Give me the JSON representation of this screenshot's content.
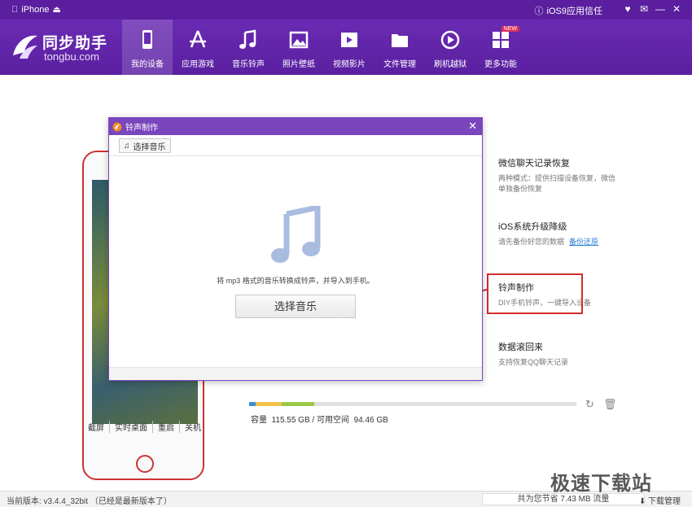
{
  "titlebar": {
    "device": "iPhone",
    "trust": "iOS9应用信任"
  },
  "brand": {
    "name": "同步助手",
    "domain": "tongbu.com"
  },
  "nav": {
    "items": [
      {
        "label": "我的设备",
        "icon": "phone-icon",
        "active": true
      },
      {
        "label": "应用游戏",
        "icon": "app-store-icon"
      },
      {
        "label": "音乐铃声",
        "icon": "music-note-icon"
      },
      {
        "label": "照片壁纸",
        "icon": "photo-icon"
      },
      {
        "label": "视频影片",
        "icon": "film-icon"
      },
      {
        "label": "文件管理",
        "icon": "folder-icon"
      },
      {
        "label": "刷机越狱",
        "icon": "flash-icon"
      },
      {
        "label": "更多功能",
        "icon": "grid-icon",
        "badge": "NEW"
      }
    ]
  },
  "dialog": {
    "title": "铃声制作",
    "select_small": "选择音乐",
    "hint": "将 mp3 格式的音乐转换成铃声，并导入到手机。",
    "select_big": "选择音乐"
  },
  "phone_actions": [
    "截屏",
    "实时桌面",
    "重启",
    "关机"
  ],
  "capacity": {
    "label": "容量",
    "total": "115.55 GB",
    "free_label": "可用空间",
    "free": "94.46 GB",
    "separator": "/",
    "used_fraction": 0.2
  },
  "features": [
    {
      "title": "微信聊天记录恢复",
      "desc": "两种模式：提供扫描设备恢复，微信单独备份恢复"
    },
    {
      "title": "iOS系统升级降级",
      "desc": "请先备份好您的数据",
      "link": "备份还原"
    },
    {
      "title": "铃声制作",
      "desc": "DIY手机铃声，一键导入设备"
    },
    {
      "title": "数据滚回来",
      "desc": "支持恢复QQ聊天记录"
    }
  ],
  "status": {
    "version": "当前版本: v3.4.4_32bit （已经是最新版本了）",
    "saved": "共为您节省  7.43 MB 流量",
    "download": "下载管理"
  },
  "watermark": "极速下载站",
  "colors": {
    "header": "#5a20a0",
    "dialog_title": "#7a45bd",
    "accent_red": "#d42c2c",
    "link": "#2b7fd9"
  }
}
